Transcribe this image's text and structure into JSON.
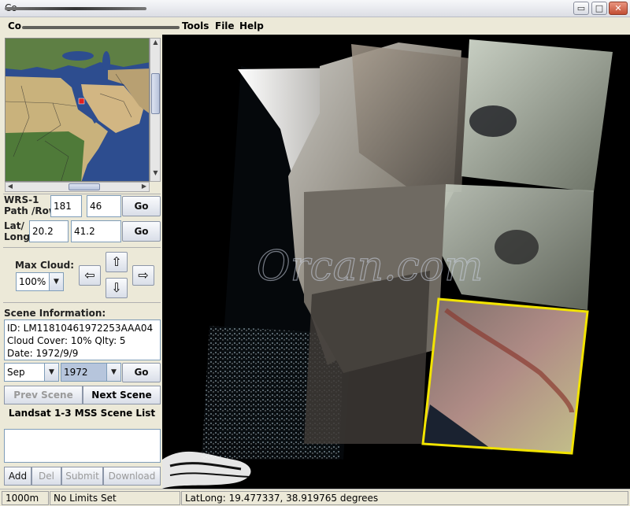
{
  "window": {
    "title": "Co",
    "minimize_glyph": "▭",
    "maximize_glyph": "□",
    "close_glyph": "✕"
  },
  "menu": {
    "app": "Co",
    "tools": "Tools",
    "file": "File",
    "help": "Help"
  },
  "wrs": {
    "label_line1": "WRS-1",
    "label_line2": "Path /Row:",
    "path": "181",
    "row": "46",
    "go": "Go"
  },
  "latlong": {
    "label_line1": "Lat/",
    "label_line2": "Long:",
    "lat": "20.2",
    "long": "41.2",
    "go": "Go"
  },
  "cloud": {
    "label": "Max Cloud:",
    "value": "100%"
  },
  "nav_icons": {
    "up": "⇧",
    "down": "⇩",
    "left": "⇦",
    "right": "⇨"
  },
  "scene_info": {
    "label": "Scene Information:",
    "id": "ID: LM11810461972253AAA04",
    "cloud": "Cloud Cover: 10%  Qlty: 5",
    "date": "Date: 1972/9/9"
  },
  "date_select": {
    "month": "Sep",
    "year": "1972",
    "go": "Go"
  },
  "scene_nav": {
    "prev": "Prev Scene",
    "next": "Next Scene"
  },
  "scene_list": {
    "title": "Landsat 1-3 MSS Scene List"
  },
  "actions": {
    "add": "Add",
    "del": "Del",
    "submit": "Submit",
    "download": "Download"
  },
  "status": {
    "scale": "1000m",
    "limits": "No Limits Set",
    "coords": "LatLong:  19.477337,  38.919765 degrees"
  },
  "colors": {
    "selection_border": "#f2e400",
    "ocean": "#000000",
    "minimap_ocean": "#2d4d8f",
    "minimap_marker": "#e02020"
  }
}
